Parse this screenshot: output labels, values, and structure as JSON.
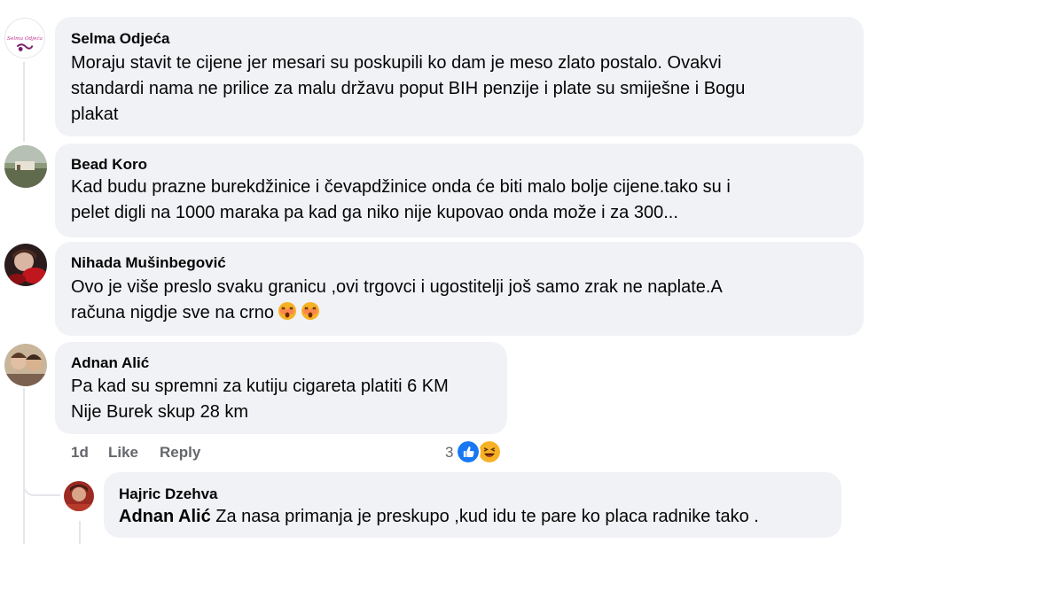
{
  "comments": [
    {
      "author": "Selma Odjeća",
      "avatar_text": "Selma Odjeća",
      "text": "Moraju stavit te cijene jer mesari su poskupili ko dam je meso zlato postalo. Ovakvi\nstandardi nama ne prilice za malu državu poput BIH penzije i plate su smiješne i Bogu\nplakat"
    },
    {
      "author": "Bead Koro",
      "text": "Kad budu prazne burekdžinice i čevapdžinice onda će biti malo bolje cijene.tako su i\npelet digli na 1000 maraka pa kad ga niko nije kupovao onda može i za 300..."
    },
    {
      "author": "Nihada Mušinbegović",
      "text_line1": "Ovo je više preslo svaku granicu ,ovi trgovci i ugostitelji još samo zrak ne naplate.A",
      "text_line2": "računa nigdje sve na crno",
      "emojis": [
        "astonished-face-icon",
        "astonished-face-icon"
      ]
    },
    {
      "author": "Adnan Alić",
      "text": "Pa kad su spremni za kutiju cigareta platiti 6 KM\nNije Burek skup 28 km",
      "time": "1d",
      "like_label": "Like",
      "reply_label": "Reply",
      "reaction_count": "3",
      "reactions": [
        "like-icon",
        "haha-icon"
      ]
    }
  ],
  "reply": {
    "author": "Hajric Dzehva",
    "mention": "Adnan Alić",
    "text": " Za nasa primanja je preskupo ,kud idu te pare ko placa radnike tako ."
  },
  "colors": {
    "bubble": "#f0f2f5",
    "meta": "#65676b",
    "like_blue": "#1877f2",
    "haha_yellow": "#f7b125"
  }
}
